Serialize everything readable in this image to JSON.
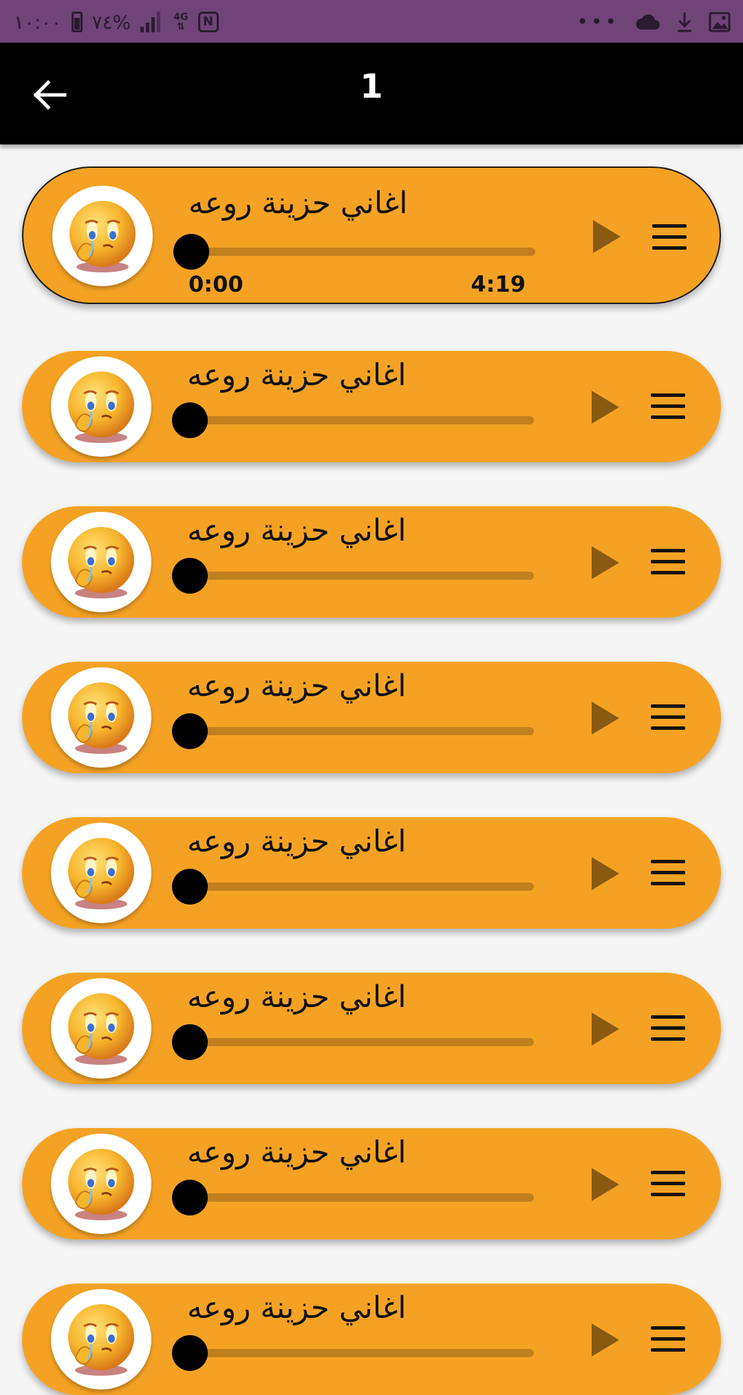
{
  "status_bar": {
    "time": "١٠:٠٠",
    "battery": "٧٤%",
    "network": "4G"
  },
  "app_bar": {
    "title": "1",
    "back_icon": "arrow-left-icon"
  },
  "tracks": [
    {
      "title": "اغاني حزينة روعه",
      "active": true,
      "current": "0:00",
      "duration": "4:19",
      "progress": 0
    },
    {
      "title": "اغاني حزينة روعه",
      "active": false,
      "progress": 0
    },
    {
      "title": "اغاني حزينة روعه",
      "active": false,
      "progress": 0
    },
    {
      "title": "اغاني حزينة روعه",
      "active": false,
      "progress": 0
    },
    {
      "title": "اغاني حزينة روعه",
      "active": false,
      "progress": 0
    },
    {
      "title": "اغاني حزينة روعه",
      "active": false,
      "progress": 0
    },
    {
      "title": "اغاني حزينة روعه",
      "active": false,
      "progress": 0
    },
    {
      "title": "اغاني حزينة روعه",
      "active": false,
      "progress": 0
    }
  ],
  "colors": {
    "status_bar": "#6f4577",
    "app_bar": "#000000",
    "card": "#f5a224",
    "seek_track": "#c17f1e",
    "play_icon": "#8a5a12"
  },
  "icons": {
    "avatar": "crying-emoji-icon",
    "play": "play-icon",
    "menu": "hamburger-menu-icon"
  }
}
